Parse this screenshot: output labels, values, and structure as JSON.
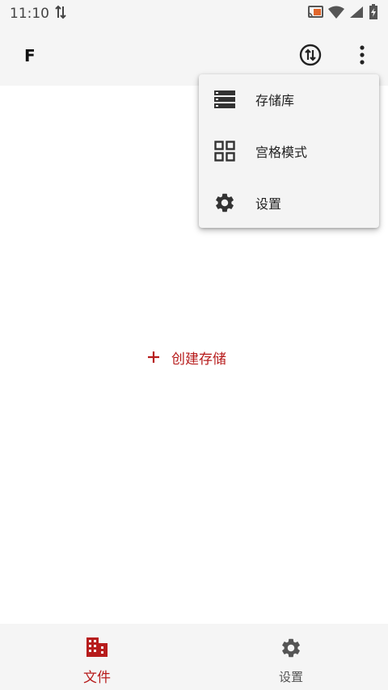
{
  "status_bar": {
    "time": "11:10",
    "icons": [
      "data-transfer-icon",
      "cast-icon",
      "wifi-icon",
      "signal-icon",
      "battery-charging-icon"
    ]
  },
  "app_bar": {
    "title": "F",
    "actions": [
      "sync-transfer-icon",
      "more-vert-icon"
    ]
  },
  "menu": {
    "items": [
      {
        "label": "存储库",
        "icon": "storage-list-icon"
      },
      {
        "label": "宫格模式",
        "icon": "grid-view-icon"
      },
      {
        "label": "设置",
        "icon": "settings-gear-icon"
      }
    ]
  },
  "main": {
    "create_icon": "plus-icon",
    "create_label": "创建存储"
  },
  "bottom_nav": {
    "items": [
      {
        "label": "文件",
        "icon": "files-building-icon",
        "active": true
      },
      {
        "label": "设置",
        "icon": "settings-gear-icon",
        "active": false
      }
    ]
  },
  "colors": {
    "accent": "#b71c1c",
    "surface": "#f5f5f5",
    "icon_dark": "#333333"
  }
}
